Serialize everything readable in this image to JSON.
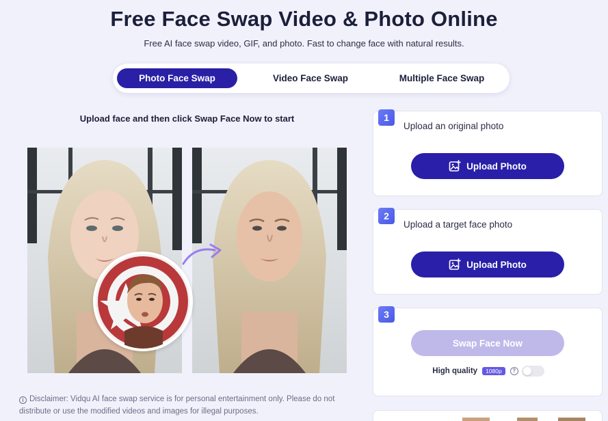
{
  "header": {
    "title": "Free Face Swap Video & Photo Online",
    "subtitle": "Free AI face swap video, GIF, and photo. Fast to change face with natural results."
  },
  "tabs": [
    {
      "label": "Photo Face Swap",
      "active": true
    },
    {
      "label": "Video Face Swap",
      "active": false
    },
    {
      "label": "Multiple Face Swap",
      "active": false
    }
  ],
  "demo": {
    "hint": "Upload face and then click Swap Face Now to start"
  },
  "steps": [
    {
      "number": "1",
      "label": "Upload an original photo",
      "button": "Upload Photo"
    },
    {
      "number": "2",
      "label": "Upload a target face photo",
      "button": "Upload Photo"
    },
    {
      "number": "3",
      "button": "Swap Face Now"
    }
  ],
  "quality": {
    "label": "High quality",
    "badge": "1080p",
    "help": "?",
    "enabled": false
  },
  "disclaimer": {
    "icon": "i",
    "text": "Disclaimer: Vidqu AI face swap service is for personal entertainment only. Please do not distribute or use the modified videos and images for illegal purposes."
  },
  "colors": {
    "accent": "#2a1fa8",
    "accent_disabled": "#bfb9ea",
    "background": "#f1f1fb",
    "badge": "#6558e2"
  }
}
